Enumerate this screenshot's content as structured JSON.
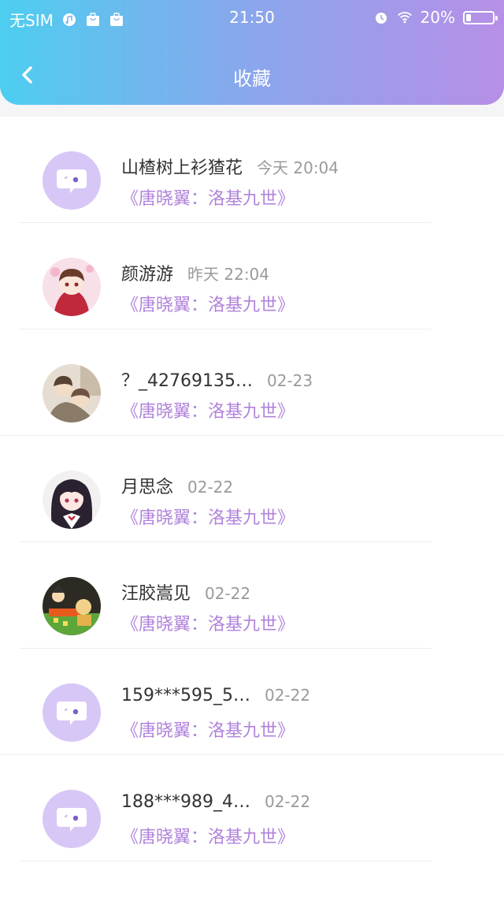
{
  "status_bar": {
    "carrier": "无SIM",
    "time": "21:50",
    "battery": "20%"
  },
  "header": {
    "title": "收藏"
  },
  "items": [
    {
      "name": "山楂树上衫猹花",
      "date": "今天 20:04",
      "book": "《唐晓翼：洛基九世》",
      "avatar": "default-chat-avatar"
    },
    {
      "name": "颜游游",
      "date": "昨天 22:04",
      "book": "《唐晓翼：洛基九世》",
      "avatar": "anime-girl-red-avatar"
    },
    {
      "name": "？_42769135…",
      "date": "02-23",
      "book": "《唐晓翼：洛基九世》",
      "avatar": "anime-group-avatar"
    },
    {
      "name": "月思念",
      "date": "02-22",
      "book": "《唐晓翼：洛基九世》",
      "avatar": "anime-girl-dark-hair-avatar"
    },
    {
      "name": "汪胶嵩见",
      "date": "02-22",
      "book": "《唐晓翼：洛基九世》",
      "avatar": "cartoon-scene-avatar"
    },
    {
      "name": "159***595_5…",
      "date": "02-22",
      "book": "《唐晓翼：洛基九世》",
      "avatar": "default-chat-avatar"
    },
    {
      "name": "188***989_4…",
      "date": "02-22",
      "book": "《唐晓翼：洛基九世》",
      "avatar": "default-chat-avatar"
    }
  ],
  "colors": {
    "header_start": "#4dcef0",
    "header_end": "#b78fe6",
    "book_title": "#b083db",
    "default_avatar_bg": "#d7c7f6"
  }
}
